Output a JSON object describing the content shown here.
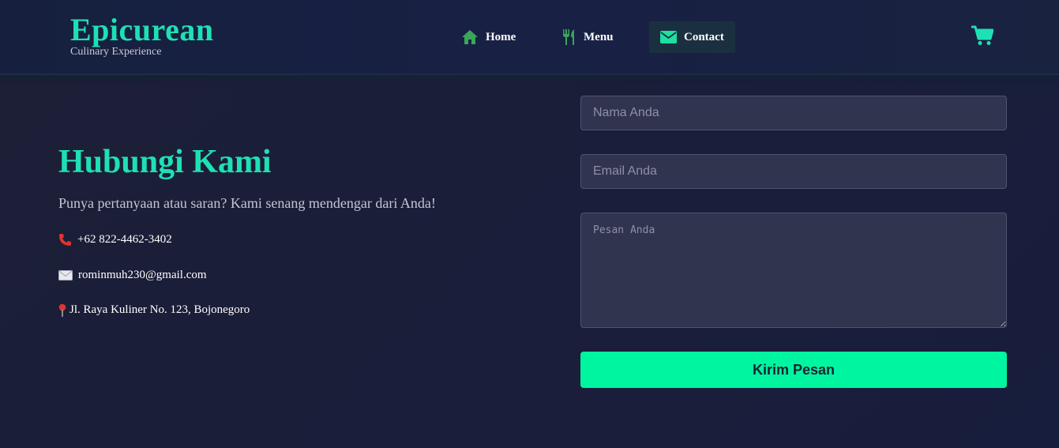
{
  "brand": {
    "name": "Epicurean",
    "tagline": "Culinary Experience"
  },
  "nav": {
    "items": [
      {
        "label": "Home",
        "icon": "home-icon"
      },
      {
        "label": "Menu",
        "icon": "utensils-icon"
      },
      {
        "label": "Contact",
        "icon": "envelope-icon",
        "active": true
      }
    ]
  },
  "cart": {
    "icon": "cart-icon"
  },
  "contact": {
    "title": "Hubungi Kami",
    "subtitle": "Punya pertanyaan atau saran? Kami senang mendengar dari Anda!",
    "phone": "+62 822-4462-3402",
    "email": "rominmuh230@gmail.com",
    "address": "Jl. Raya Kuliner No. 123, Bojonegoro"
  },
  "form": {
    "name_placeholder": "Nama Anda",
    "email_placeholder": "Email Anda",
    "message_placeholder": "Pesan Anda",
    "submit_label": "Kirim Pesan"
  },
  "colors": {
    "accent": "#1ee0b4",
    "button": "#00f5a0",
    "background": "#1a1e3a",
    "header": "#17203f",
    "active_nav": "#1a3040"
  }
}
